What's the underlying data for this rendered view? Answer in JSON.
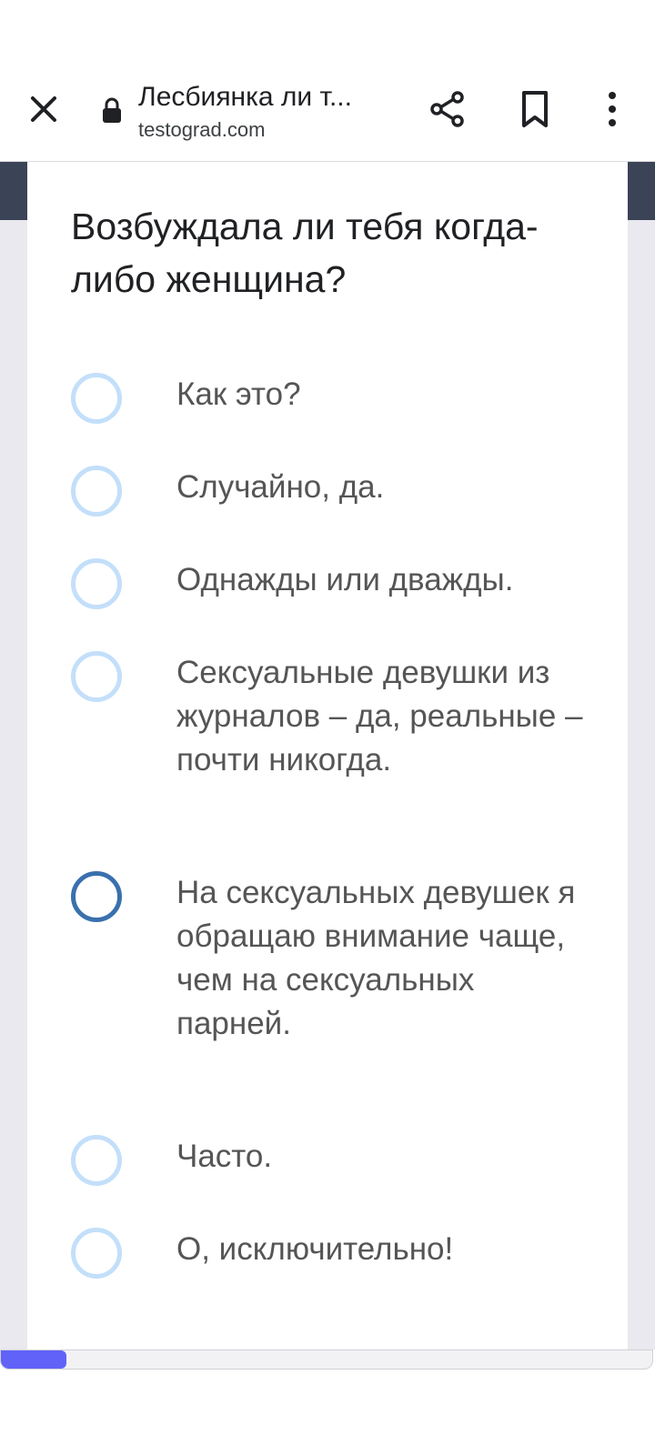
{
  "toolbar": {
    "close_icon": "close-icon",
    "lock_icon": "lock-icon",
    "title": "Лесбиянка ли т...",
    "url": "testograd.com",
    "share_icon": "share-icon",
    "bookmark_icon": "bookmark-icon",
    "menu_icon": "more-vert-icon"
  },
  "quiz": {
    "question": "Возбуждала ли тебя когда-либо женщина?",
    "options": [
      {
        "label": "Как это?",
        "selected": false
      },
      {
        "label": "Случайно, да.",
        "selected": false
      },
      {
        "label": "Однажды или дважды.",
        "selected": false
      },
      {
        "label": "Сексуальные девушки из журналов – да, реальные – почти никогда.",
        "selected": false
      },
      {
        "label": "На сексуальных девушек я обращаю внимание чаще, чем на сексуальных парней.",
        "selected": true
      },
      {
        "label": "Часто.",
        "selected": false
      },
      {
        "label": "О, исключительно!",
        "selected": false
      }
    ]
  },
  "progress": {
    "fraction": 0.1
  },
  "colors": {
    "radio_border": "#c3dffa",
    "radio_selected": "#3a70ad",
    "progress_fill": "#6062f8",
    "header_strip": "#3b4356"
  }
}
